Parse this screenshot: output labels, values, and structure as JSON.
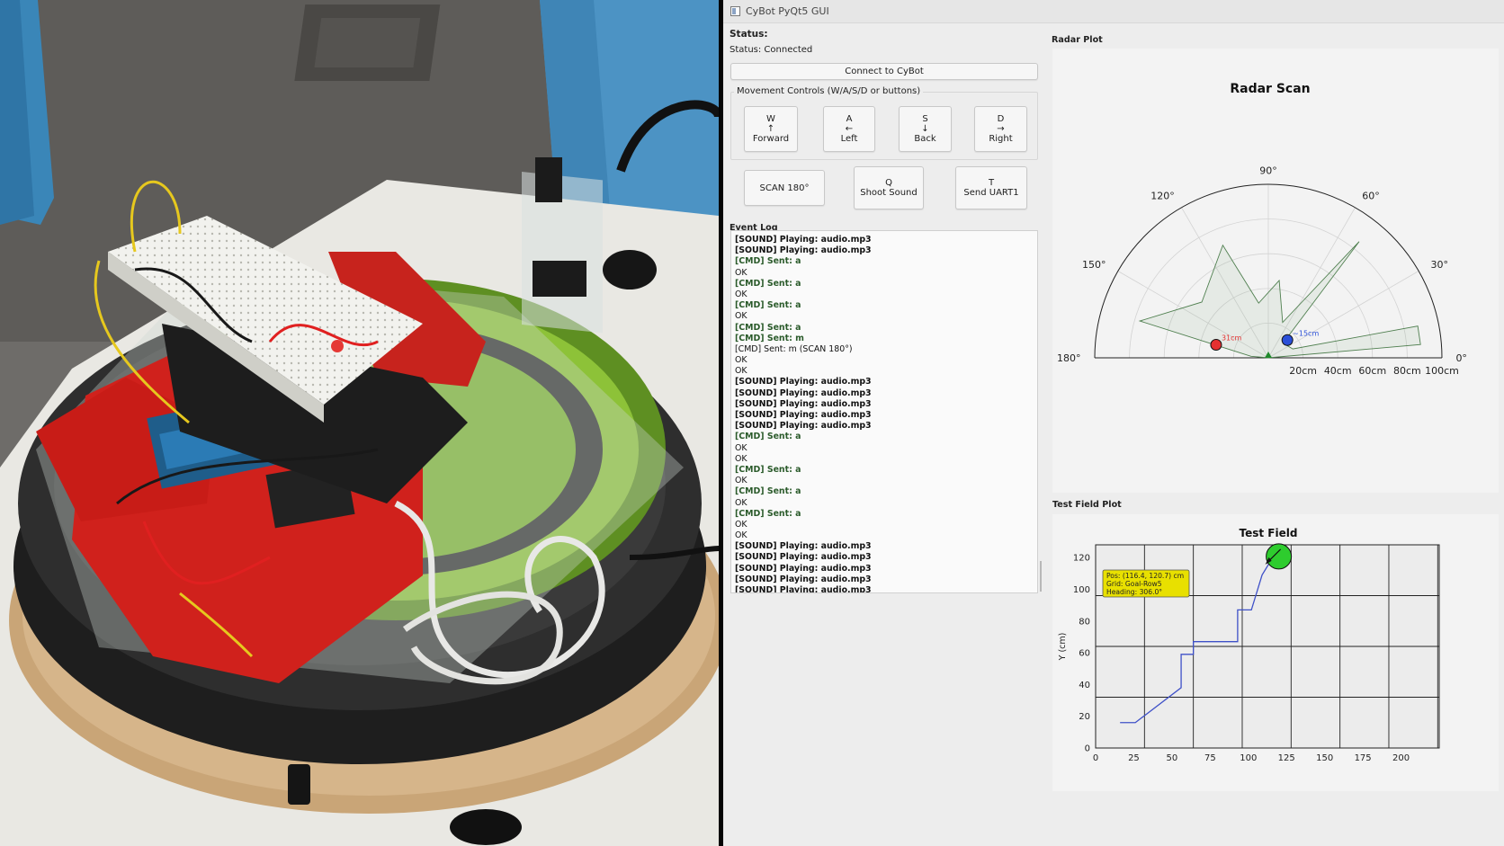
{
  "window": {
    "title": "CyBot PyQt5 GUI",
    "icon": "app-window-icon"
  },
  "status": {
    "heading": "Status:",
    "text": "Status: Connected"
  },
  "connect_button": "Connect to CyBot",
  "movement": {
    "group_title": "Movement Controls (W/A/S/D or buttons)",
    "buttons": [
      {
        "key": "W",
        "arrow": "↑",
        "label": "Forward"
      },
      {
        "key": "A",
        "arrow": "←",
        "label": "Left"
      },
      {
        "key": "S",
        "arrow": "↓",
        "label": "Back"
      },
      {
        "key": "D",
        "arrow": "→",
        "label": "Right"
      }
    ]
  },
  "actions": [
    {
      "key": "",
      "label": "SCAN 180°"
    },
    {
      "key": "Q",
      "label": "Shoot Sound"
    },
    {
      "key": "T",
      "label": "Send UART1"
    }
  ],
  "event_log": {
    "heading": "Event Log",
    "lines": [
      {
        "tag": "[SOUND]",
        "text": " Playing: audio.mp3",
        "style": "b"
      },
      {
        "tag": "[SOUND]",
        "text": " Playing: audio.mp3",
        "style": "b"
      },
      {
        "tag": "[CMD]",
        "text": " Sent: a",
        "style": "g"
      },
      {
        "tag": "",
        "text": "OK",
        "style": ""
      },
      {
        "tag": "[CMD]",
        "text": " Sent: a",
        "style": "g"
      },
      {
        "tag": "",
        "text": "OK",
        "style": ""
      },
      {
        "tag": "[CMD]",
        "text": " Sent: a",
        "style": "g"
      },
      {
        "tag": "",
        "text": "OK",
        "style": ""
      },
      {
        "tag": "[CMD]",
        "text": " Sent: a",
        "style": "g"
      },
      {
        "tag": "[CMD]",
        "text": " Sent: m",
        "style": "g"
      },
      {
        "tag": "",
        "text": "[CMD] Sent: m (SCAN 180°)",
        "style": ""
      },
      {
        "tag": "",
        "text": "OK",
        "style": ""
      },
      {
        "tag": "",
        "text": "OK",
        "style": ""
      },
      {
        "tag": "[SOUND]",
        "text": " Playing: audio.mp3",
        "style": "b"
      },
      {
        "tag": "[SOUND]",
        "text": " Playing: audio.mp3",
        "style": "b"
      },
      {
        "tag": "[SOUND]",
        "text": " Playing: audio.mp3",
        "style": "b"
      },
      {
        "tag": "[SOUND]",
        "text": " Playing: audio.mp3",
        "style": "b"
      },
      {
        "tag": "[SOUND]",
        "text": " Playing: audio.mp3",
        "style": "b"
      },
      {
        "tag": "[CMD]",
        "text": " Sent: a",
        "style": "g"
      },
      {
        "tag": "",
        "text": "OK",
        "style": ""
      },
      {
        "tag": "",
        "text": "OK",
        "style": ""
      },
      {
        "tag": "[CMD]",
        "text": " Sent: a",
        "style": "g"
      },
      {
        "tag": "",
        "text": "OK",
        "style": ""
      },
      {
        "tag": "[CMD]",
        "text": " Sent: a",
        "style": "g"
      },
      {
        "tag": "",
        "text": "OK",
        "style": ""
      },
      {
        "tag": "[CMD]",
        "text": " Sent: a",
        "style": "g"
      },
      {
        "tag": "",
        "text": "OK",
        "style": ""
      },
      {
        "tag": "",
        "text": "OK",
        "style": ""
      },
      {
        "tag": "[SOUND]",
        "text": " Playing: audio.mp3",
        "style": "b"
      },
      {
        "tag": "[SOUND]",
        "text": " Playing: audio.mp3",
        "style": "b"
      },
      {
        "tag": "[SOUND]",
        "text": " Playing: audio.mp3",
        "style": "b"
      },
      {
        "tag": "[SOUND]",
        "text": " Playing: audio.mp3",
        "style": "b"
      },
      {
        "tag": "[SOUND]",
        "text": " Playing: audio.mp3",
        "style": "b"
      }
    ]
  },
  "radar_panel": {
    "heading": "Radar Plot"
  },
  "field_panel": {
    "heading": "Test Field Plot"
  },
  "chart_data": [
    {
      "type": "polar",
      "title": "Radar Scan",
      "theta_range_deg": [
        0,
        180
      ],
      "angle_ticks": [
        "0°",
        "30°",
        "60°",
        "90°",
        "120°",
        "150°",
        "180°"
      ],
      "radial_ticks": [
        "20cm",
        "40cm",
        "60cm",
        "80cm",
        "100cm"
      ],
      "r_max": 100,
      "scan_profile": [
        {
          "theta": 5,
          "r": 88
        },
        {
          "theta": 12,
          "r": 88
        },
        {
          "theta": 20,
          "r": 15
        },
        {
          "theta": 45,
          "r": 12
        },
        {
          "theta": 52,
          "r": 85
        },
        {
          "theta": 68,
          "r": 22
        },
        {
          "theta": 82,
          "r": 45
        },
        {
          "theta": 100,
          "r": 32
        },
        {
          "theta": 112,
          "r": 70
        },
        {
          "theta": 140,
          "r": 50
        },
        {
          "theta": 164,
          "r": 77
        },
        {
          "theta": 175,
          "r": 10
        }
      ],
      "objects": [
        {
          "label": "31cm",
          "theta": 166,
          "r": 31,
          "color": "#e53030"
        },
        {
          "label": "~15cm",
          "theta": 43,
          "r": 15,
          "color": "#2a4fd8"
        }
      ],
      "grid": true
    },
    {
      "type": "line",
      "title": "Test Field",
      "ylabel": "Y (cm)",
      "xlabel": "",
      "xlim": [
        0,
        225
      ],
      "ylim": [
        0,
        128
      ],
      "x_ticks": [
        0,
        25,
        50,
        75,
        100,
        125,
        150,
        175,
        200
      ],
      "y_ticks": [
        0,
        20,
        40,
        60,
        80,
        100,
        120
      ],
      "grid_x": [
        0,
        32,
        64,
        96,
        128,
        160,
        192,
        224
      ],
      "grid_y": [
        0,
        32,
        64,
        96,
        128
      ],
      "path": [
        [
          16,
          16
        ],
        [
          26,
          16
        ],
        [
          56,
          38
        ],
        [
          56,
          59
        ],
        [
          64,
          59
        ],
        [
          64,
          67
        ],
        [
          93,
          67
        ],
        [
          93,
          87
        ],
        [
          102,
          87
        ],
        [
          109,
          109
        ],
        [
          116.4,
          120.7
        ]
      ],
      "goal": {
        "x": 116.4,
        "y": 120.7,
        "color": "#2ecc2e"
      },
      "heading_deg": 306.0,
      "tooltip": [
        "Pos: (116.4, 120.7) cm",
        "Grid: Goal-Row5",
        "Heading: 306.0°"
      ],
      "grid": true
    }
  ]
}
